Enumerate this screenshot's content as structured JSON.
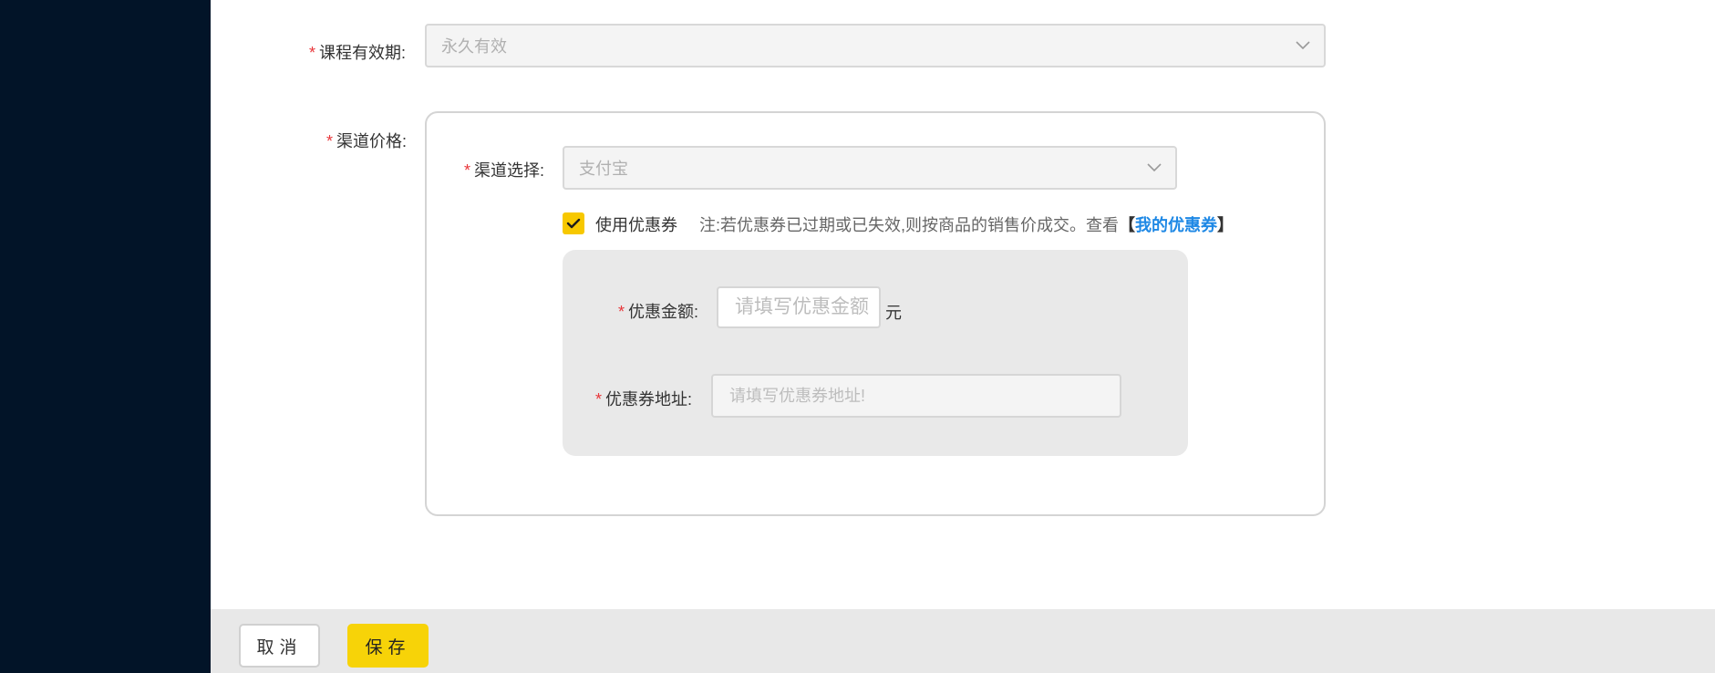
{
  "form": {
    "validity": {
      "label": "课程有效期:",
      "value": "永久有效"
    },
    "channel_price": {
      "label": "渠道价格:",
      "channel": {
        "label": "渠道选择:",
        "value": "支付宝"
      },
      "use_coupon": {
        "label": "使用优惠券",
        "checked": true
      },
      "note": {
        "text": "注:若优惠券已过期或已失效,则按商品的销售价成交。查看",
        "bracket_open": "【",
        "link": "我的优惠券",
        "bracket_close": "】"
      },
      "coupon_amount": {
        "label": "优惠金额:",
        "placeholder": "请填写优惠金额",
        "unit": "元"
      },
      "coupon_url": {
        "label": "优惠券地址:",
        "placeholder": "请填写优惠券地址!"
      }
    }
  },
  "required_mark": "*",
  "footer": {
    "cancel_label": "取消",
    "save_label": "保存"
  },
  "colors": {
    "sidebar": "#021428",
    "accent": "#f7d308",
    "link": "#1e88e5",
    "required": "#e8363a"
  }
}
